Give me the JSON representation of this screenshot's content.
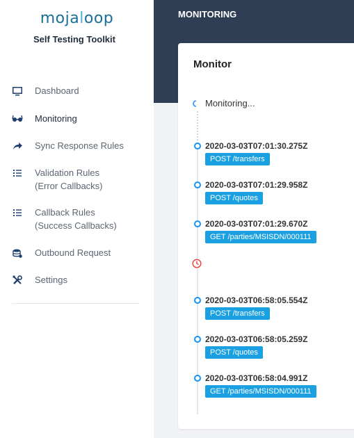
{
  "brand": {
    "logo_a": "moja",
    "logo_b": "l",
    "logo_c": "oop",
    "subtitle": "Self Testing Toolkit"
  },
  "sidebar": {
    "items": [
      {
        "label": "Dashboard",
        "icon": "monitor-icon"
      },
      {
        "label": "Monitoring",
        "icon": "glasses-icon",
        "active": true
      },
      {
        "label": "Sync Response Rules",
        "icon": "share-arrow-icon"
      },
      {
        "label": "Validation Rules",
        "label2": "(Error Callbacks)",
        "icon": "list-icon"
      },
      {
        "label": "Callback Rules",
        "label2": "(Success Callbacks)",
        "icon": "list-icon"
      },
      {
        "label": "Outbound Request",
        "icon": "database-icon"
      },
      {
        "label": "Settings",
        "icon": "tools-icon"
      }
    ]
  },
  "header": {
    "title": "MONITORING"
  },
  "monitor": {
    "title": "Monitor",
    "status": "Monitoring...",
    "events": [
      {
        "time": "2020-03-03T07:01:30.275Z",
        "tag": "POST /transfers"
      },
      {
        "time": "2020-03-03T07:01:29.958Z",
        "tag": "POST /quotes"
      },
      {
        "time": "2020-03-03T07:01:29.670Z",
        "tag": "GET /parties/MSISDN/000111"
      },
      {
        "time": "2020-03-03T06:58:05.554Z",
        "tag": "POST /transfers"
      },
      {
        "time": "2020-03-03T06:58:05.259Z",
        "tag": "POST /quotes"
      },
      {
        "time": "2020-03-03T06:58:04.991Z",
        "tag": "GET /parties/MSISDN/000111"
      }
    ]
  },
  "colors": {
    "accent": "#1890ff",
    "tag_bg": "#1ba0e2",
    "header_bg": "#2f3d55",
    "clock": "#e8453c"
  }
}
